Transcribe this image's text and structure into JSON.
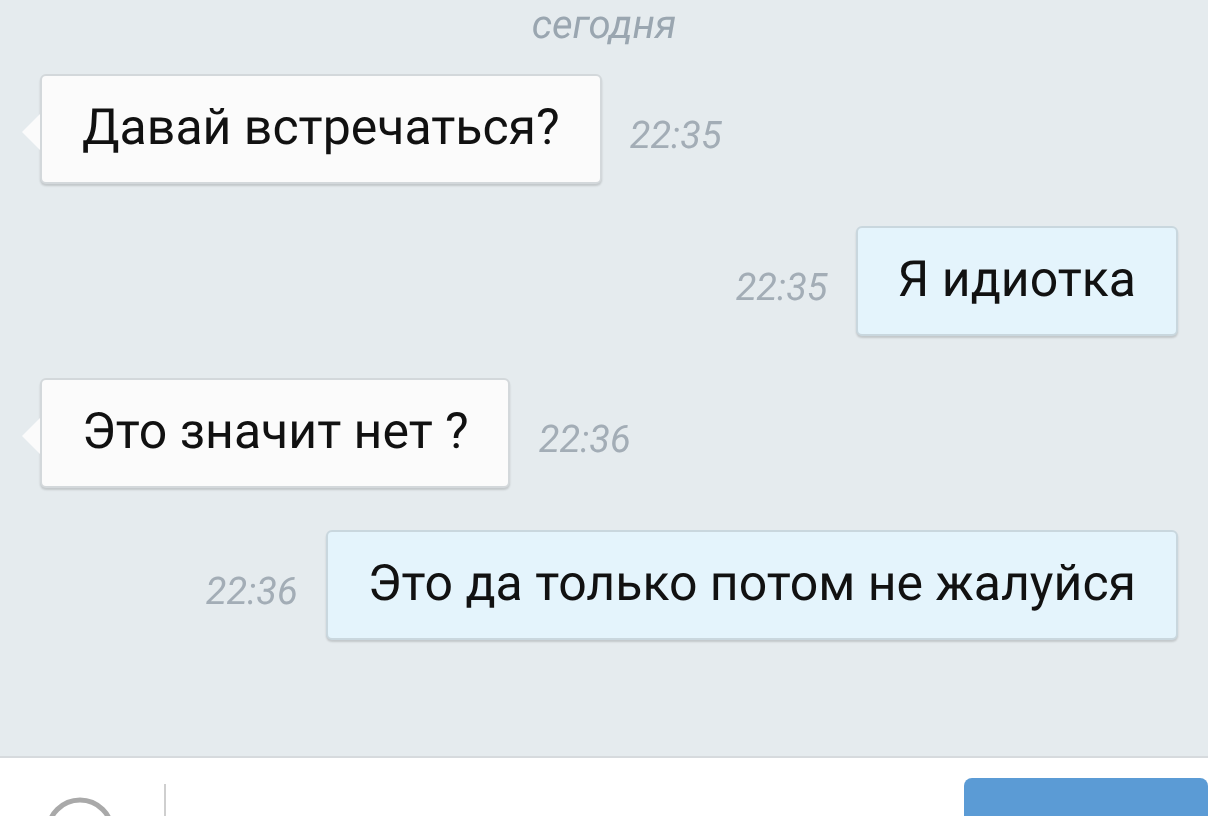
{
  "date_separator": "сегодня",
  "messages": [
    {
      "kind": "incoming",
      "text": "Давай встречаться?",
      "time": "22:35"
    },
    {
      "kind": "outgoing",
      "text": "Я идиотка",
      "time": "22:35"
    },
    {
      "kind": "incoming",
      "text": "Это значит нет ?",
      "time": "22:36"
    },
    {
      "kind": "outgoing",
      "text": "Это да только потом не жалуйся",
      "time": "22:36"
    }
  ]
}
